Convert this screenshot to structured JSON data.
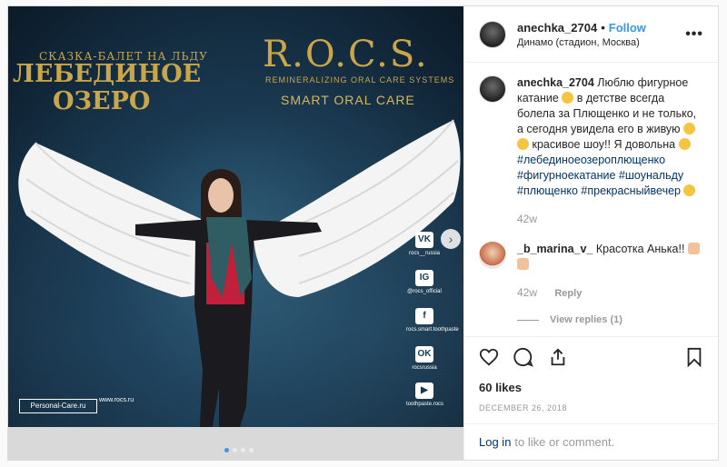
{
  "post": {
    "username": "anechka_2704",
    "follow_label": "Follow",
    "location": "Динамо (стадион, Москва)",
    "more_icon": "more-dots-icon"
  },
  "photo": {
    "poster_subtitle": "СКАЗКА-БАЛЕТ НА ЛЬДУ",
    "poster_title_line1": "ЛЕБЕДИНОЕ",
    "poster_title_line2": "ОЗЕРО",
    "brand": "R.O.C.S.",
    "brand_sub": "REMINERALIZING ORAL CARE SYSTEMS",
    "brand_tagline": "SMART ORAL CARE",
    "social": [
      {
        "icon": "VK",
        "label": "rocs__russia"
      },
      {
        "icon": "IG",
        "label": "@rocs_official"
      },
      {
        "icon": "f",
        "label": "rocs.smart.toothpaste"
      },
      {
        "icon": "OK",
        "label": "rocsrussia"
      },
      {
        "icon": "▶",
        "label": "toothpaste.rocs"
      }
    ],
    "partner_logo": "Personal-Care.ru",
    "site": "www.rocs.ru",
    "carousel_total": 4,
    "carousel_current": 1
  },
  "caption": {
    "username": "anechka_2704",
    "text_part1": "Люблю фигурное катание",
    "text_part2": "в детстве всегда болела за Плющенко и не только, а сегодня увидела его в живую",
    "text_part3": "красивое шоу!! Я довольна",
    "hashtags": "#лебединоеозероплющенко #фигурноекатание #шоунальду #плющенко #прекрасныйвечер",
    "time": "42w"
  },
  "comment": {
    "username": "_b_marina_v_",
    "text": "Красотка Анька!!",
    "time": "42w",
    "reply_label": "Reply",
    "view_replies": "View replies (1)"
  },
  "stats": {
    "likes": "60 likes",
    "date": "DECEMBER 26, 2018"
  },
  "footer": {
    "login_link": "Log in",
    "login_text": "to like or comment."
  }
}
